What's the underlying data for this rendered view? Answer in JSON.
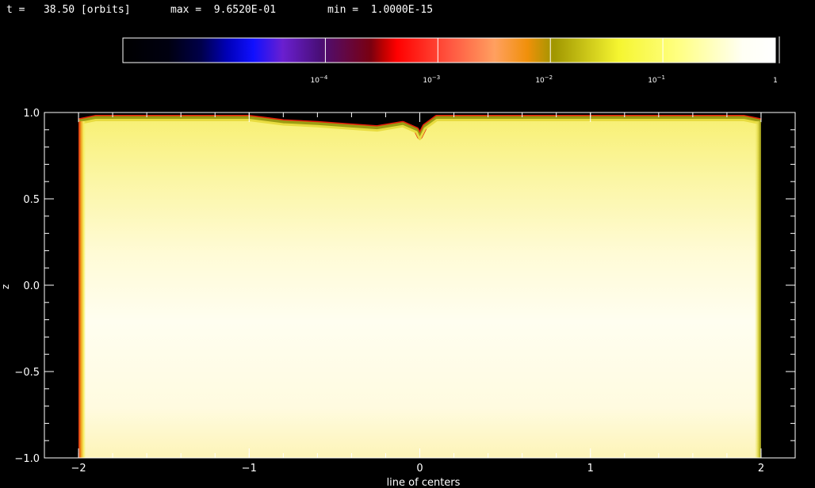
{
  "header": {
    "t_label": "t =   38.50 [orbits]",
    "max_label": "max =  9.6520E-01",
    "min_label": "min =  1.0000E-15"
  },
  "colorbar": {
    "tick_labels": [
      {
        "base": "10",
        "exp": "-4"
      },
      {
        "base": "10",
        "exp": "-3"
      },
      {
        "base": "10",
        "exp": "-2"
      },
      {
        "base": "10",
        "exp": "-1"
      },
      {
        "base": "1",
        "exp": ""
      }
    ]
  },
  "chart_data": {
    "type": "heatmap",
    "title": "",
    "xlabel": "line of centers",
    "ylabel": "z",
    "xlim": [
      -2.2,
      2.2
    ],
    "ylim": [
      -1.0,
      1.0
    ],
    "x_ticks": [
      -2,
      -1,
      0,
      1,
      2
    ],
    "y_ticks": [
      -1.0,
      -0.5,
      0.0,
      0.5,
      1.0
    ],
    "x_tick_labels": [
      "−2",
      "−1",
      "0",
      "1",
      "2"
    ],
    "y_tick_labels": [
      "−1.0",
      "−0.5",
      "0.0",
      "0.5",
      "1.0"
    ],
    "scale": "log",
    "value_range": [
      1e-15,
      0.9652
    ],
    "colorbar_ticks": [
      0.0001,
      0.001,
      0.01,
      0.1,
      1
    ],
    "region": {
      "x_min": -2.0,
      "x_max": 2.0,
      "z_min": -1.0,
      "z_max": 1.0
    },
    "top_surface": [
      {
        "x": -2.0,
        "z": 0.95
      },
      {
        "x": -1.9,
        "z": 0.97
      },
      {
        "x": -1.0,
        "z": 0.97
      },
      {
        "x": -0.8,
        "z": 0.945
      },
      {
        "x": -0.6,
        "z": 0.935
      },
      {
        "x": -0.4,
        "z": 0.92
      },
      {
        "x": -0.25,
        "z": 0.91
      },
      {
        "x": -0.1,
        "z": 0.935
      },
      {
        "x": -0.02,
        "z": 0.9
      },
      {
        "x": 0.0,
        "z": 0.86
      },
      {
        "x": 0.03,
        "z": 0.92
      },
      {
        "x": 0.1,
        "z": 0.97
      },
      {
        "x": 1.0,
        "z": 0.97
      },
      {
        "x": 1.9,
        "z": 0.97
      },
      {
        "x": 2.0,
        "z": 0.95
      }
    ]
  },
  "colors": {
    "background": "#000000",
    "axis": "#ffffff",
    "fill_core": "#fffde8",
    "fill_upper": "#fbf494",
    "edge_red": "#e8200a",
    "edge_olive": "#9a9a10"
  }
}
